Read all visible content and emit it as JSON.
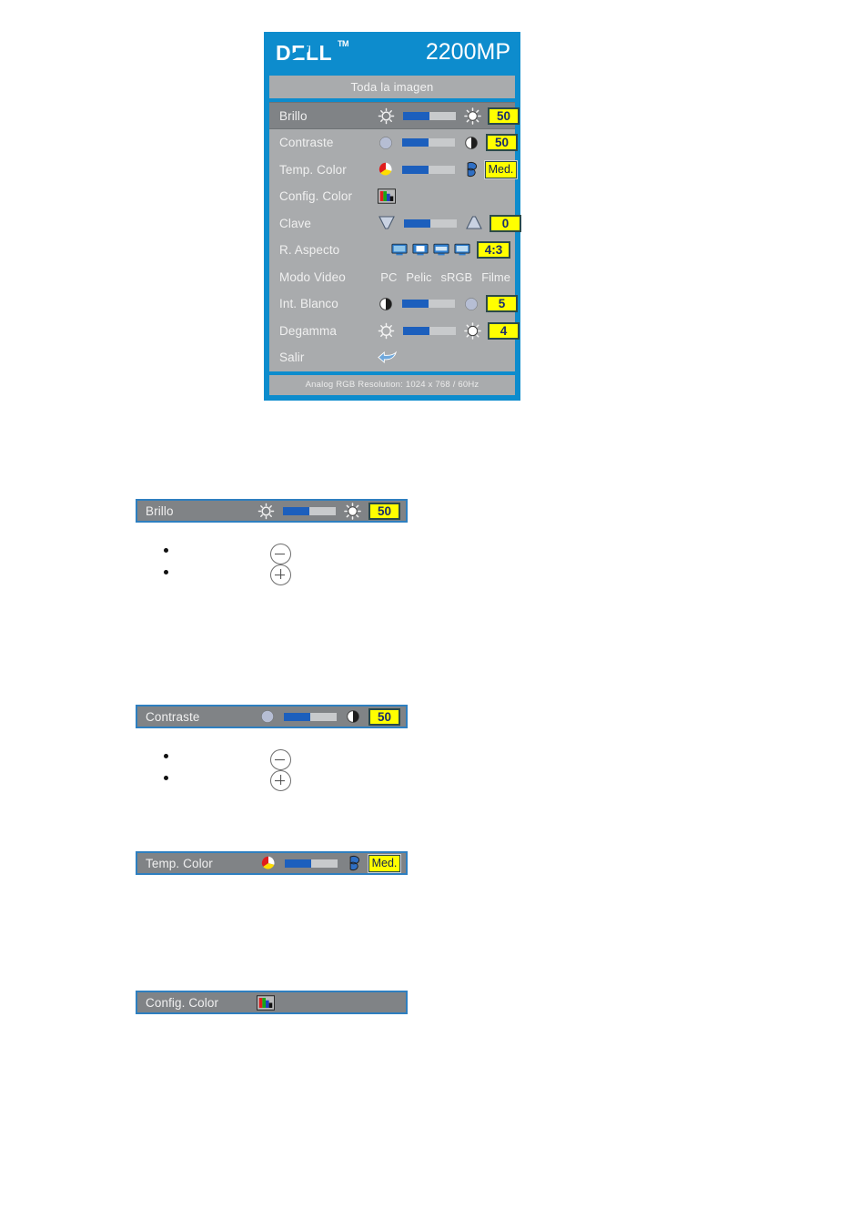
{
  "osd": {
    "brand": "DELL",
    "brand_tm": "TM",
    "model": "2200MP",
    "subtitle": "Toda la imagen",
    "footer": "Analog RGB Resolution: 1024 x 768 / 60Hz",
    "colors": {
      "panel_blue": "#0d8ccd",
      "menu_gray": "#a9abad",
      "selected_gray": "#808386",
      "value_yellow": "#ffff00",
      "slider_fill": "#1c5fbd",
      "slider_track": "#c8cacc",
      "bar_border_blue": "#2e7fc0"
    },
    "rows": [
      {
        "label": "Brillo",
        "selected": true,
        "type": "slider",
        "fill_pct": 50,
        "value": "50",
        "icon_left": "brightness-low-icon",
        "icon_right": "brightness-high-icon"
      },
      {
        "label": "Contraste",
        "selected": false,
        "type": "slider",
        "fill_pct": 50,
        "value": "50",
        "icon_left": "contrast-low-icon",
        "icon_right": "contrast-high-icon"
      },
      {
        "label": "Temp. Color",
        "selected": false,
        "type": "slider",
        "fill_pct": 50,
        "value": "Med.",
        "icon_left": "warm-color-icon",
        "icon_right": "cool-color-icon"
      },
      {
        "label": "Config. Color",
        "selected": false,
        "type": "icon-only",
        "icon_left": "color-bars-icon"
      },
      {
        "label": "Clave",
        "selected": false,
        "type": "slider",
        "fill_pct": 50,
        "value": "0",
        "icon_left": "keystone-down-icon",
        "icon_right": "keystone-up-icon"
      },
      {
        "label": "R. Aspecto",
        "selected": false,
        "type": "aspect",
        "value": "4:3",
        "icons": [
          "aspect-full-icon",
          "aspect-4-3-icon",
          "aspect-16-9-icon",
          "aspect-wide-icon"
        ]
      },
      {
        "label": "Modo Video",
        "selected": false,
        "type": "modes",
        "modes": [
          "PC",
          "Pelic",
          "sRGB",
          "Filme"
        ]
      },
      {
        "label": "Int. Blanco",
        "selected": false,
        "type": "slider",
        "fill_pct": 50,
        "value": "5",
        "icon_left": "contrast-high-icon",
        "icon_right": "contrast-low-icon"
      },
      {
        "label": "Degamma",
        "selected": false,
        "type": "slider",
        "fill_pct": 50,
        "value": "4",
        "icon_left": "gamma-low-icon",
        "icon_right": "gamma-high-icon"
      },
      {
        "label": "Salir",
        "selected": false,
        "type": "exit",
        "icon_left": "return-arrow-icon"
      }
    ]
  },
  "detail_bars": [
    {
      "label": "Brillo",
      "value": "50",
      "type": "slider",
      "fill_pct": 50
    },
    {
      "label": "Contraste",
      "value": "50",
      "type": "slider",
      "fill_pct": 50
    },
    {
      "label": "Temp. Color",
      "value": "Med.",
      "type": "slider",
      "fill_pct": 50
    },
    {
      "label": "Config. Color",
      "value": "",
      "type": "icon-only",
      "fill_pct": 0
    }
  ],
  "adjust_hints": [
    {
      "icon": "minus-circle-icon",
      "text": ""
    },
    {
      "icon": "plus-circle-icon",
      "text": ""
    }
  ]
}
